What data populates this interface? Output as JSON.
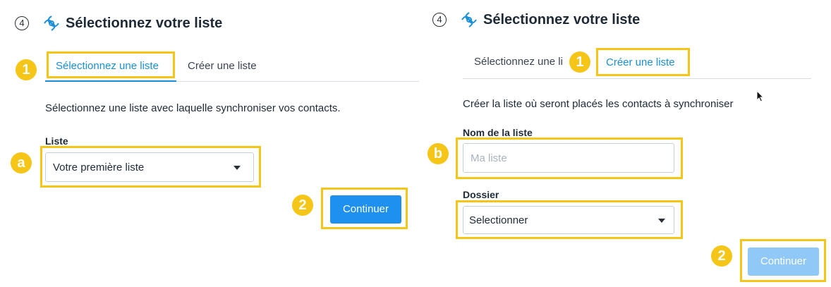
{
  "left": {
    "step_number": "4",
    "title": "Sélectionnez votre liste",
    "tabs": [
      {
        "label": "Sélectionnez une liste",
        "active": true
      },
      {
        "label": "Créer une liste",
        "active": false
      }
    ],
    "badge_tab": "1",
    "description": "Sélectionnez une liste avec laquelle synchroniser vos contacts.",
    "list_label": "Liste",
    "list_value": "Votre première liste",
    "badge_field": "a",
    "badge_button": "2",
    "continue_label": "Continuer"
  },
  "right": {
    "step_number": "4",
    "title": "Sélectionnez votre liste",
    "tabs": [
      {
        "label": "Sélectionnez une li",
        "active": false
      },
      {
        "label": "Créer une liste",
        "active": true
      }
    ],
    "badge_tab": "1",
    "description": "Créer la liste où seront placés les contacts à synchroniser",
    "name_label": "Nom de la liste",
    "name_placeholder": "Ma liste",
    "badge_field": "b",
    "folder_label": "Dossier",
    "folder_value": "Selectionner",
    "badge_button": "2",
    "continue_label": "Continuer"
  },
  "colors": {
    "accent": "#1a8fd8",
    "button_enabled": "#1e90f0",
    "button_disabled": "#90c8f8",
    "highlight": "#f5c518"
  },
  "icons": [
    "sendinblue-logo-icon",
    "cursor-arrow-icon"
  ]
}
